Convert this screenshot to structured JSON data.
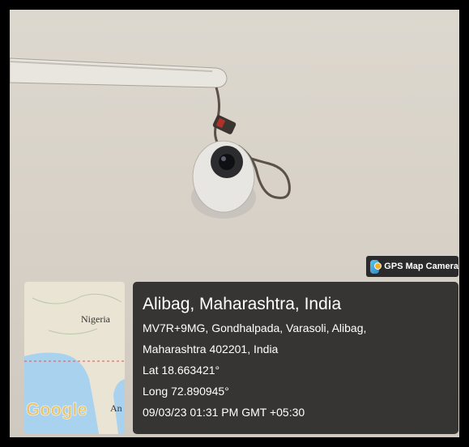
{
  "badge": {
    "label": "GPS Map Camera",
    "icon": "gps-map-camera-app-icon"
  },
  "map": {
    "country_label": "Nigeria",
    "partial_label": "An",
    "brand": "Google"
  },
  "info": {
    "title": "Alibag, Maharashtra, India",
    "address_line1": "MV7R+9MG, Gondhalpada, Varasoli, Alibag,",
    "address_line2": "Maharashtra 402201, India",
    "latitude": "Lat 18.663421°",
    "longitude": "Long 72.890945°",
    "datetime": "09/03/23 01:31 PM GMT +05:30"
  },
  "colors": {
    "info_bg": "#1c1c1c",
    "map_water": "#a9d2ef",
    "map_land": "#e9e4d4",
    "wall": "#d8d2c8"
  }
}
